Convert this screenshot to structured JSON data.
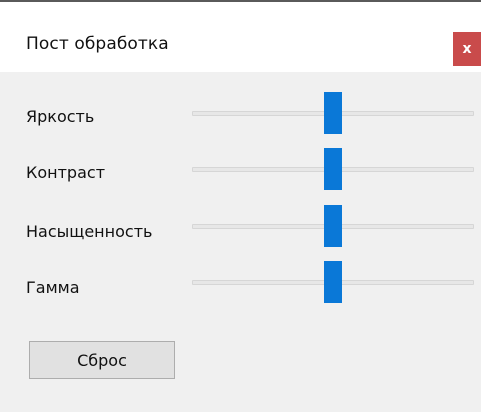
{
  "window": {
    "title": "Пост обработка",
    "close_label": "x"
  },
  "colors": {
    "accent": "#0a78d7",
    "close": "#c94b4b",
    "background": "#f0f0f0"
  },
  "sliders": [
    {
      "label": "Яркость",
      "value": 0.5
    },
    {
      "label": "Контраст",
      "value": 0.5
    },
    {
      "label": "Насыщенность",
      "value": 0.5
    },
    {
      "label": "Гамма",
      "value": 0.5
    }
  ],
  "reset_label": "Сброс"
}
